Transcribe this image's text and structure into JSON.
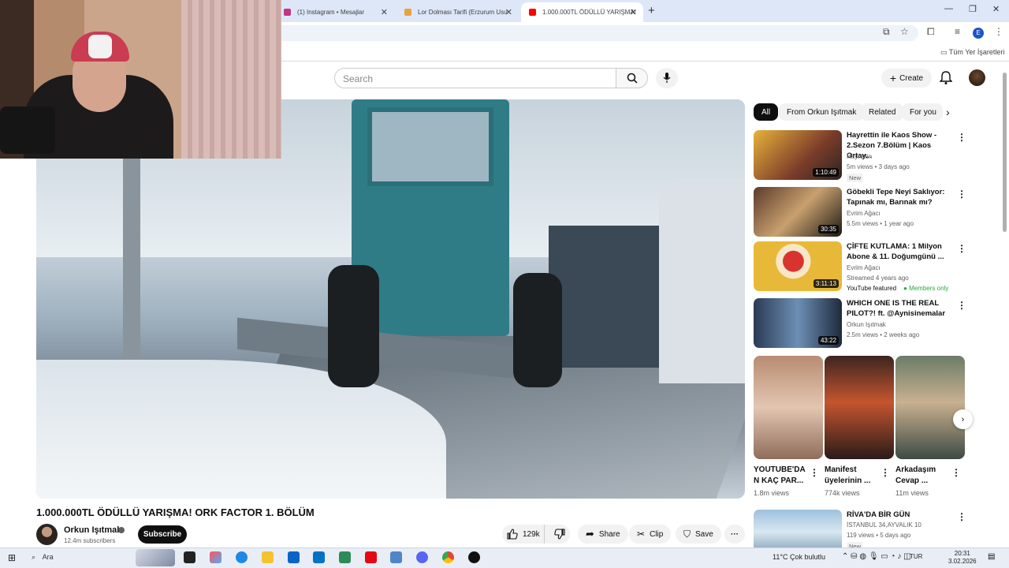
{
  "browser": {
    "tabs": [
      {
        "label": "(1) Instagram • Mesajlar",
        "color": "#c13584"
      },
      {
        "label": "Lor Dolması Tarifi (Erzurum Usu",
        "color": "#e8a33d"
      },
      {
        "label": "1.000.000TL ÖDÜLLÜ YARIŞMA!",
        "color": "#ff0000"
      }
    ],
    "new_tab": "+",
    "profile_initial": "E",
    "bookmarks_folder": "Tüm Yer İşaretleri"
  },
  "masthead": {
    "search_placeholder": "Search",
    "create_label": "Create"
  },
  "video": {
    "title": "1.000.000TL ÖDÜLLÜ YARIŞMA! ORK FACTOR 1. BÖLÜM",
    "channel": "Orkun Işıtmak",
    "subscribers": "12.4m subscribers",
    "subscribe_label": "Subscribe",
    "likes": "129k",
    "share_label": "Share",
    "clip_label": "Clip",
    "save_label": "Save"
  },
  "chips": [
    "All",
    "From Orkun Işıtmak",
    "Related",
    "For you"
  ],
  "recommendations": [
    {
      "title": "Hayrettin ile Kaos Show - 2.Sezon 7.Bölüm | Kaos Ortay...",
      "channel": "Hayrettin",
      "meta": "5m views • 3 days ago",
      "duration": "1:10:49",
      "badge": "New",
      "thumb": "#c88a2e"
    },
    {
      "title": "Göbekli Tepe Neyi Saklıyor: Tapınak mı, Barınak mı?",
      "channel": "Evrim Ağacı",
      "meta": "5.5m views • 1 year ago",
      "duration": "30:35",
      "thumb": "#3a2a24"
    },
    {
      "title": "ÇİFTE KUTLAMA: 1 Milyon Abone & 11. Doğumgünü ...",
      "channel": "Evrim Ağacı",
      "meta": "Streamed 4 years ago",
      "duration": "3:11:13",
      "featured": "YouTube featured",
      "members": "Members only",
      "thumb": "#e2b23a"
    },
    {
      "title": "WHICH ONE IS THE REAL PILOT?! ft. @Aynisinemalar",
      "channel": "Orkun Işıtmak",
      "meta": "2.5m views • 2 weeks ago",
      "duration": "43:22",
      "thumb": "#3f6d9a"
    }
  ],
  "shorts": [
    {
      "title": "YOUTUBE'DA N KAÇ PAR...",
      "views": "1.8m views",
      "thumb": "#c9a892"
    },
    {
      "title": "Manifest üyelerinin ...",
      "views": "774k views",
      "thumb": "#b5553a"
    },
    {
      "title": "Arkadaşım Cevap ...",
      "views": "11m views",
      "thumb": "#5e7563"
    }
  ],
  "bottom_rec": {
    "title": "RİVA'DA BİR GÜN",
    "channel": "İSTANBUL 34,AYVALIK 10",
    "meta": "119 views • 5 days ago",
    "badge": "New",
    "thumb": "#7fa8c9"
  },
  "taskbar": {
    "search": "Ara",
    "weather": "11°C  Çok bulutlu",
    "lang": "TUR",
    "time": "20:31",
    "date": "3.02.2026"
  }
}
